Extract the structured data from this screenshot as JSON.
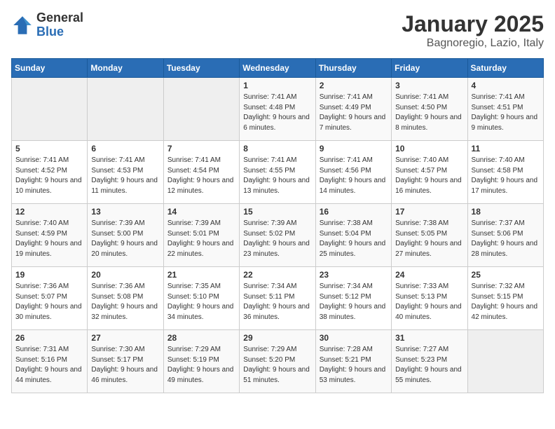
{
  "header": {
    "logo_general": "General",
    "logo_blue": "Blue",
    "month": "January 2025",
    "location": "Bagnoregio, Lazio, Italy"
  },
  "weekdays": [
    "Sunday",
    "Monday",
    "Tuesday",
    "Wednesday",
    "Thursday",
    "Friday",
    "Saturday"
  ],
  "weeks": [
    [
      {
        "day": "",
        "empty": true
      },
      {
        "day": "",
        "empty": true
      },
      {
        "day": "",
        "empty": true
      },
      {
        "day": "1",
        "sunrise": "7:41 AM",
        "sunset": "4:48 PM",
        "daylight": "9 hours and 6 minutes."
      },
      {
        "day": "2",
        "sunrise": "7:41 AM",
        "sunset": "4:49 PM",
        "daylight": "9 hours and 7 minutes."
      },
      {
        "day": "3",
        "sunrise": "7:41 AM",
        "sunset": "4:50 PM",
        "daylight": "9 hours and 8 minutes."
      },
      {
        "day": "4",
        "sunrise": "7:41 AM",
        "sunset": "4:51 PM",
        "daylight": "9 hours and 9 minutes."
      }
    ],
    [
      {
        "day": "5",
        "sunrise": "7:41 AM",
        "sunset": "4:52 PM",
        "daylight": "9 hours and 10 minutes."
      },
      {
        "day": "6",
        "sunrise": "7:41 AM",
        "sunset": "4:53 PM",
        "daylight": "9 hours and 11 minutes."
      },
      {
        "day": "7",
        "sunrise": "7:41 AM",
        "sunset": "4:54 PM",
        "daylight": "9 hours and 12 minutes."
      },
      {
        "day": "8",
        "sunrise": "7:41 AM",
        "sunset": "4:55 PM",
        "daylight": "9 hours and 13 minutes."
      },
      {
        "day": "9",
        "sunrise": "7:41 AM",
        "sunset": "4:56 PM",
        "daylight": "9 hours and 14 minutes."
      },
      {
        "day": "10",
        "sunrise": "7:40 AM",
        "sunset": "4:57 PM",
        "daylight": "9 hours and 16 minutes."
      },
      {
        "day": "11",
        "sunrise": "7:40 AM",
        "sunset": "4:58 PM",
        "daylight": "9 hours and 17 minutes."
      }
    ],
    [
      {
        "day": "12",
        "sunrise": "7:40 AM",
        "sunset": "4:59 PM",
        "daylight": "9 hours and 19 minutes."
      },
      {
        "day": "13",
        "sunrise": "7:39 AM",
        "sunset": "5:00 PM",
        "daylight": "9 hours and 20 minutes."
      },
      {
        "day": "14",
        "sunrise": "7:39 AM",
        "sunset": "5:01 PM",
        "daylight": "9 hours and 22 minutes."
      },
      {
        "day": "15",
        "sunrise": "7:39 AM",
        "sunset": "5:02 PM",
        "daylight": "9 hours and 23 minutes."
      },
      {
        "day": "16",
        "sunrise": "7:38 AM",
        "sunset": "5:04 PM",
        "daylight": "9 hours and 25 minutes."
      },
      {
        "day": "17",
        "sunrise": "7:38 AM",
        "sunset": "5:05 PM",
        "daylight": "9 hours and 27 minutes."
      },
      {
        "day": "18",
        "sunrise": "7:37 AM",
        "sunset": "5:06 PM",
        "daylight": "9 hours and 28 minutes."
      }
    ],
    [
      {
        "day": "19",
        "sunrise": "7:36 AM",
        "sunset": "5:07 PM",
        "daylight": "9 hours and 30 minutes."
      },
      {
        "day": "20",
        "sunrise": "7:36 AM",
        "sunset": "5:08 PM",
        "daylight": "9 hours and 32 minutes."
      },
      {
        "day": "21",
        "sunrise": "7:35 AM",
        "sunset": "5:10 PM",
        "daylight": "9 hours and 34 minutes."
      },
      {
        "day": "22",
        "sunrise": "7:34 AM",
        "sunset": "5:11 PM",
        "daylight": "9 hours and 36 minutes."
      },
      {
        "day": "23",
        "sunrise": "7:34 AM",
        "sunset": "5:12 PM",
        "daylight": "9 hours and 38 minutes."
      },
      {
        "day": "24",
        "sunrise": "7:33 AM",
        "sunset": "5:13 PM",
        "daylight": "9 hours and 40 minutes."
      },
      {
        "day": "25",
        "sunrise": "7:32 AM",
        "sunset": "5:15 PM",
        "daylight": "9 hours and 42 minutes."
      }
    ],
    [
      {
        "day": "26",
        "sunrise": "7:31 AM",
        "sunset": "5:16 PM",
        "daylight": "9 hours and 44 minutes."
      },
      {
        "day": "27",
        "sunrise": "7:30 AM",
        "sunset": "5:17 PM",
        "daylight": "9 hours and 46 minutes."
      },
      {
        "day": "28",
        "sunrise": "7:29 AM",
        "sunset": "5:19 PM",
        "daylight": "9 hours and 49 minutes."
      },
      {
        "day": "29",
        "sunrise": "7:29 AM",
        "sunset": "5:20 PM",
        "daylight": "9 hours and 51 minutes."
      },
      {
        "day": "30",
        "sunrise": "7:28 AM",
        "sunset": "5:21 PM",
        "daylight": "9 hours and 53 minutes."
      },
      {
        "day": "31",
        "sunrise": "7:27 AM",
        "sunset": "5:23 PM",
        "daylight": "9 hours and 55 minutes."
      },
      {
        "day": "",
        "empty": true
      }
    ]
  ],
  "labels": {
    "sunrise": "Sunrise:",
    "sunset": "Sunset:",
    "daylight": "Daylight:"
  }
}
